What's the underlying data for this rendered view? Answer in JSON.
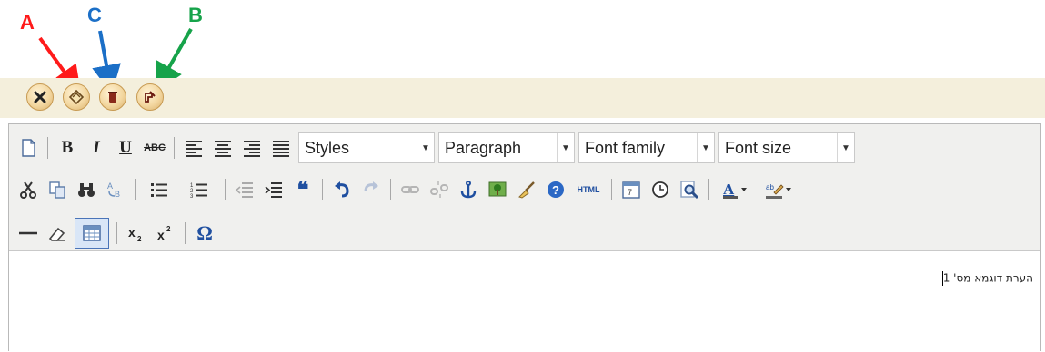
{
  "annotations": {
    "a": "A",
    "b": "B",
    "c": "C",
    "color_a": "#ff1a1a",
    "color_b": "#16a34a",
    "color_c": "#1b6fc7"
  },
  "action_bar": {
    "buttons": [
      {
        "icon": "close-x-icon"
      },
      {
        "icon": "eraser-diamond-icon"
      },
      {
        "icon": "trash-can-icon"
      },
      {
        "icon": "edit-note-icon"
      }
    ]
  },
  "toolbar": {
    "bold": "B",
    "italic": "I",
    "underline": "U",
    "strike": "ABC",
    "html": "HTML",
    "quote": "❝",
    "omega": "Ω",
    "styles": "Styles",
    "paragraph": "Paragraph",
    "font_family": "Font family",
    "font_size": "Font size"
  },
  "content": {
    "note": "הערת דוגמא מס' 1"
  },
  "colors": {
    "beige": "#f4efdc",
    "toolbar_bg": "#f0f0ee",
    "accent": "#1f4fa0"
  }
}
